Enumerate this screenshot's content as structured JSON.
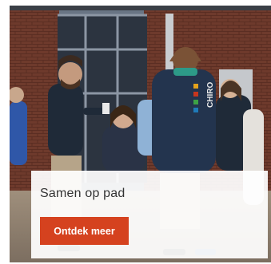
{
  "card": {
    "caption_title": "Samen op pad",
    "cta_label": "Ontdek meer",
    "jacket_print": "CHIRO"
  },
  "colors": {
    "cta_background": "#d5421f",
    "cta_text": "#ffffff",
    "caption_background": "#ffffff"
  }
}
